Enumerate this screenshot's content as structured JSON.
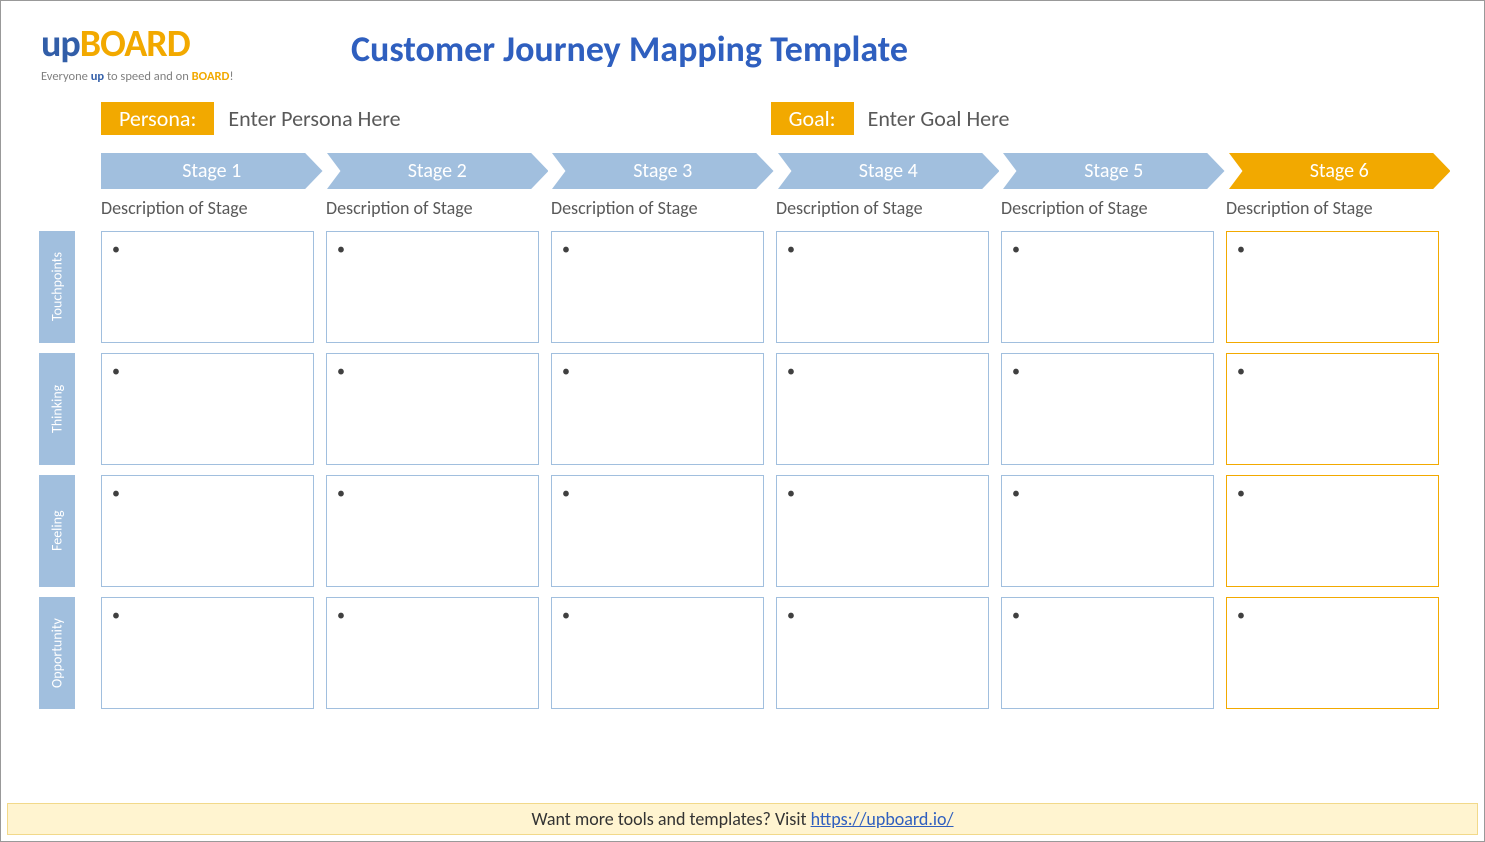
{
  "logo": {
    "part1": "up",
    "part2": "BOARD"
  },
  "tagline": {
    "pre": "Everyone ",
    "b1": "up",
    "mid": " to speed and on ",
    "b2": "BOARD",
    "post": "!"
  },
  "title": "Customer Journey Mapping Template",
  "persona": {
    "label": "Persona:",
    "value": "Enter Persona Here"
  },
  "goal": {
    "label": "Goal:",
    "value": "Enter Goal Here"
  },
  "stages": [
    {
      "name": "Stage 1",
      "desc": "Description of Stage",
      "accent": false
    },
    {
      "name": "Stage 2",
      "desc": "Description of Stage",
      "accent": false
    },
    {
      "name": "Stage 3",
      "desc": "Description of Stage",
      "accent": false
    },
    {
      "name": "Stage 4",
      "desc": "Description of Stage",
      "accent": false
    },
    {
      "name": "Stage 5",
      "desc": "Description of Stage",
      "accent": false
    },
    {
      "name": "Stage 6",
      "desc": "Description of Stage",
      "accent": true
    }
  ],
  "rows": [
    "Touchpoints",
    "Thinking",
    "Feeling",
    "Opportunity"
  ],
  "colors": {
    "blue": "#a1bfde",
    "accent": "#f2a900"
  },
  "footer": {
    "text": "Want more tools and templates? Visit ",
    "linkText": "https://upboard.io/",
    "linkHref": "https://upboard.io/"
  }
}
